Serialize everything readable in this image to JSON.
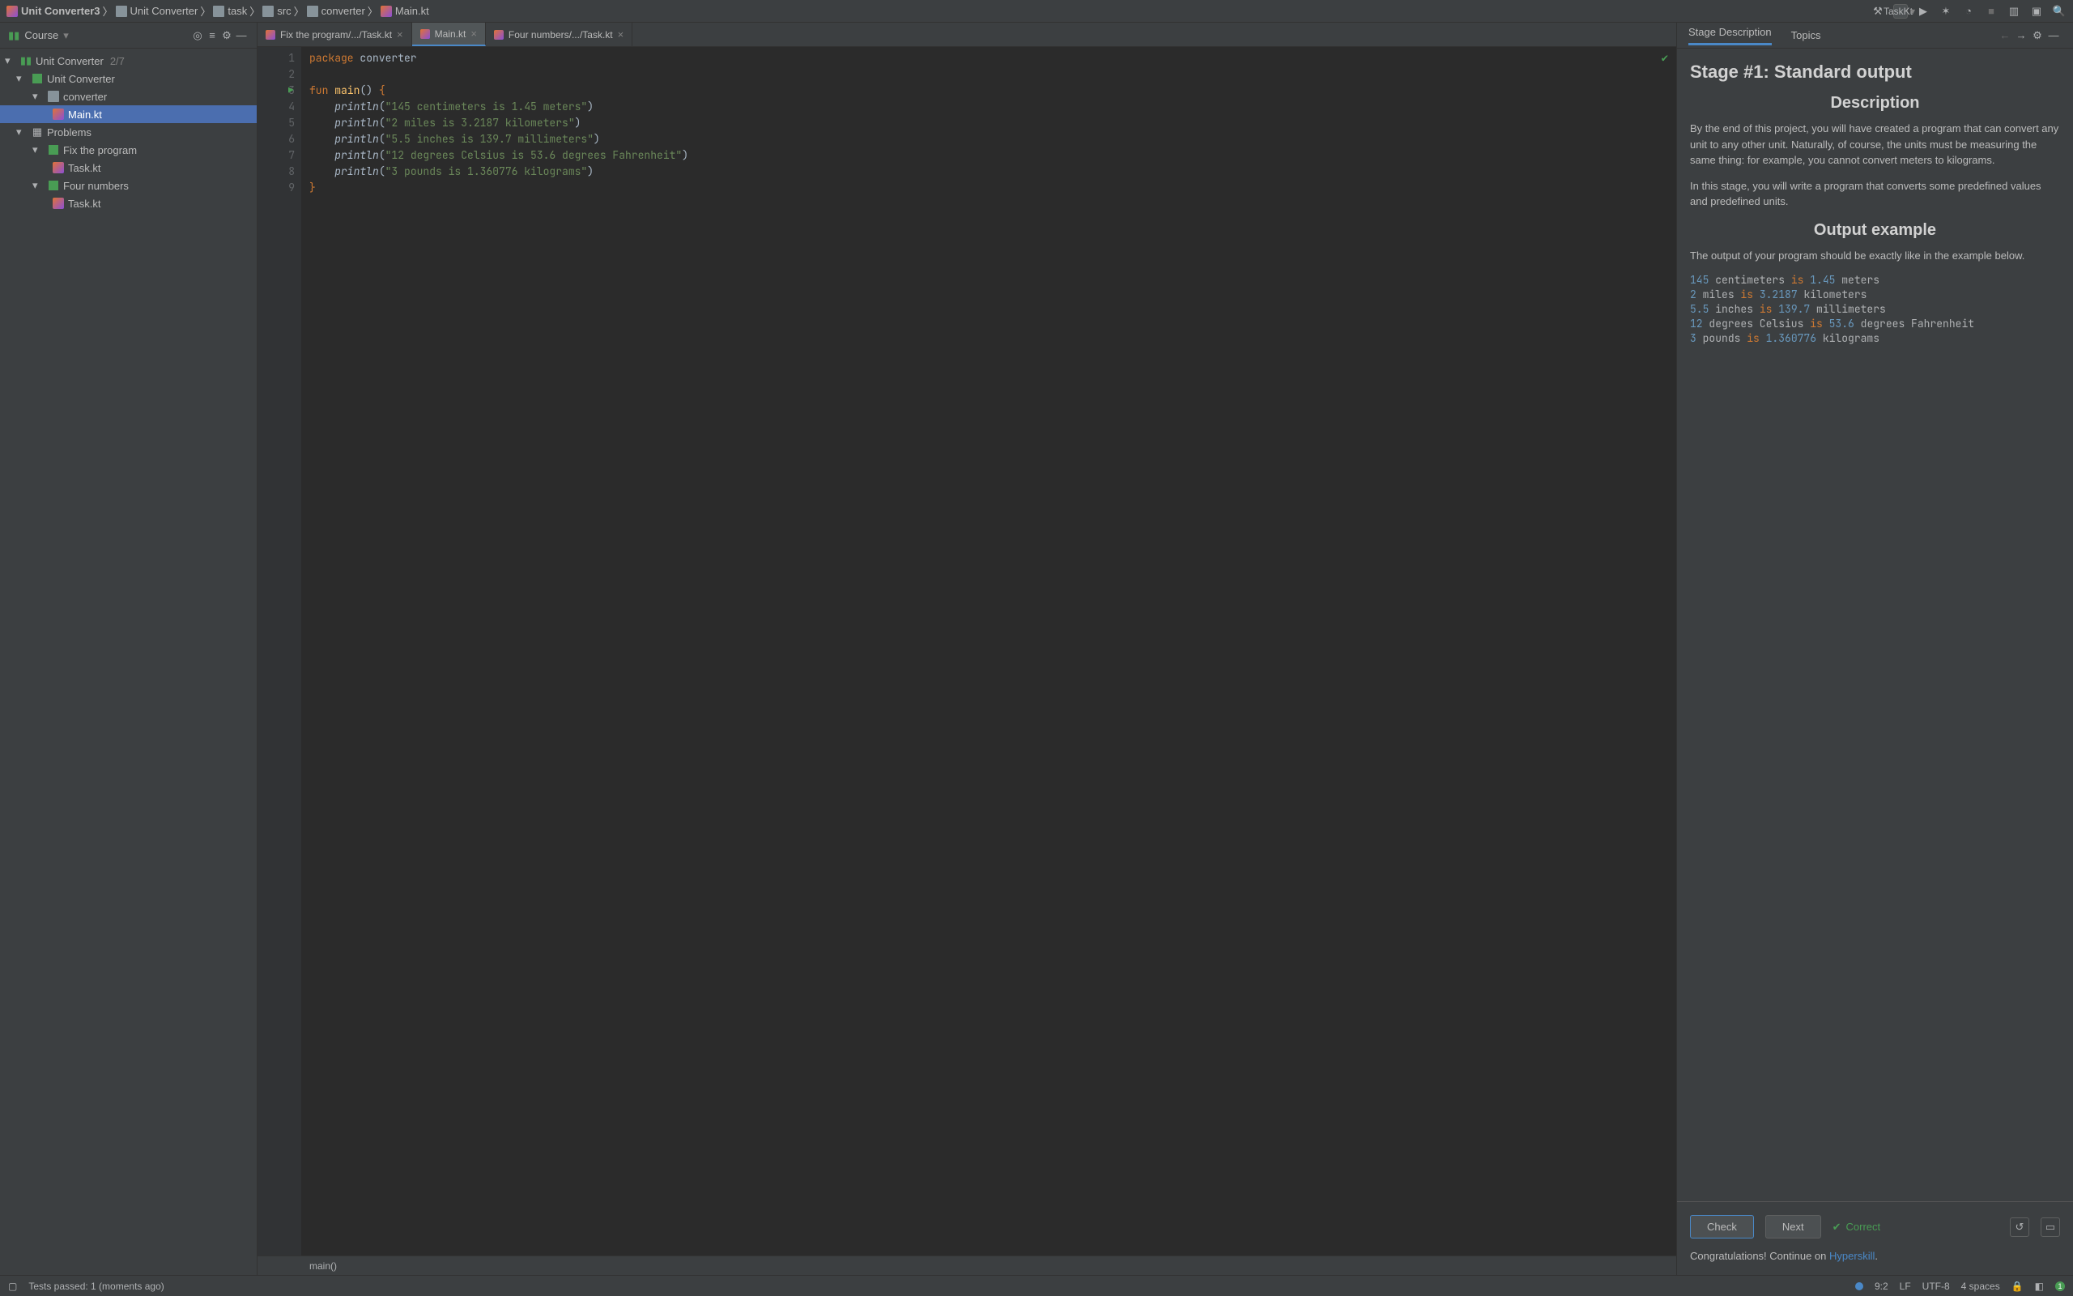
{
  "breadcrumbs": [
    "Unit Converter3",
    "Unit Converter",
    "task",
    "src",
    "converter",
    "Main.kt"
  ],
  "run_config": "TaskKt",
  "course_header": {
    "label": "Course"
  },
  "tree": {
    "root": {
      "label": "Unit Converter",
      "suffix": "2/7"
    },
    "section": {
      "label": "Unit Converter"
    },
    "folder": {
      "label": "converter"
    },
    "main_file": "Main.kt",
    "problems": "Problems",
    "fix_program": "Fix the program",
    "task1": "Task.kt",
    "four_numbers": "Four numbers",
    "task2": "Task.kt"
  },
  "tabs": [
    {
      "label": "Fix the program/.../Task.kt"
    },
    {
      "label": "Main.kt"
    },
    {
      "label": "Four numbers/.../Task.kt"
    }
  ],
  "gutter_lines": [
    "1",
    "2",
    "3",
    "4",
    "5",
    "6",
    "7",
    "8",
    "9"
  ],
  "code": {
    "l1a": "package",
    "l1b": " converter",
    "l3a": "fun ",
    "l3b": "main",
    "l3c": "() ",
    "l3d": "{",
    "l4a": "    ",
    "l4b": "println",
    "l4c": "(",
    "l4d": "\"145 centimeters is 1.45 meters\"",
    "l4e": ")",
    "l5a": "    ",
    "l5b": "println",
    "l5c": "(",
    "l5d": "\"2 miles is 3.2187 kilometers\"",
    "l5e": ")",
    "l6a": "    ",
    "l6b": "println",
    "l6c": "(",
    "l6d": "\"5.5 inches is 139.7 millimeters\"",
    "l6e": ")",
    "l7a": "    ",
    "l7b": "println",
    "l7c": "(",
    "l7d": "\"12 degrees Celsius is 53.6 degrees Fahrenheit\"",
    "l7e": ")",
    "l8a": "    ",
    "l8b": "println",
    "l8c": "(",
    "l8d": "\"3 pounds is 1.360776 kilograms\"",
    "l8e": ")",
    "l9": "}"
  },
  "editor_footer": "main()",
  "desc_tabs": {
    "stage": "Stage Description",
    "topics": "Topics"
  },
  "desc": {
    "title": "Stage #1: Standard output",
    "h_desc": "Description",
    "p1": "By the end of this project, you will have created a program that can convert any unit to any other unit. Naturally, of course, the units must be measuring the same thing: for example, you cannot convert meters to kilograms.",
    "p2": "In this stage, you will write a program that converts some predefined values and predefined units.",
    "h_output": "Output example",
    "p3": "The output of your program should be exactly like in the example below.",
    "sample_lines": [
      {
        "n": "145",
        "t1": " centimeters ",
        "k": "is",
        "n2": " 1.45",
        "t2": " meters"
      },
      {
        "n": "2",
        "t1": " miles ",
        "k": "is",
        "n2": " 3.2187",
        "t2": " kilometers"
      },
      {
        "n": "5.5",
        "t1": " inches ",
        "k": "is",
        "n2": " 139.7",
        "t2": " millimeters"
      },
      {
        "n": "12",
        "t1": " degrees Celsius ",
        "k": "is",
        "n2": " 53.6",
        "t2": " degrees Fahrenheit"
      },
      {
        "n": "3",
        "t1": " pounds ",
        "k": "is",
        "n2": " 1.360776",
        "t2": " kilograms"
      }
    ]
  },
  "buttons": {
    "check": "Check",
    "next": "Next",
    "correct": "Correct"
  },
  "congrats": {
    "text": "Congratulations! Continue on ",
    "link": "Hyperskill",
    "dot": "."
  },
  "status": {
    "tests": "Tests passed: 1 (moments ago)",
    "pos": "9:2",
    "lf": "LF",
    "enc": "UTF-8",
    "indent": "4 spaces",
    "badge": "1"
  }
}
